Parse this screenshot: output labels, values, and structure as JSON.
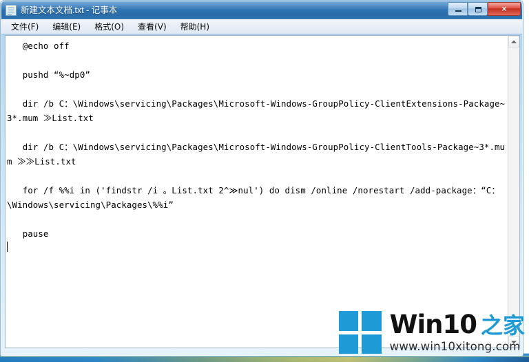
{
  "window": {
    "title": "新建文本文档.txt - 记事本",
    "icon": "notepad-icon",
    "caption": {
      "minimize_label": "最小化",
      "maximize_label": "最大化",
      "close_label": "×"
    }
  },
  "menu": {
    "items": [
      {
        "label": "文件(F)",
        "name": "menu-file"
      },
      {
        "label": "编辑(E)",
        "name": "menu-edit"
      },
      {
        "label": "格式(O)",
        "name": "menu-format"
      },
      {
        "label": "查看(V)",
        "name": "menu-view"
      },
      {
        "label": "帮助(H)",
        "name": "menu-help"
      }
    ]
  },
  "editor": {
    "content": "   @echo off\n\n   pushd “%~dp0”\n\n   dir /b C：\\Windows\\servicing\\Packages\\Microsoft-Windows-GroupPolicy-ClientExtensions-Package~3*.mum ≫List.txt\n\n   dir /b C：\\Windows\\servicing\\Packages\\Microsoft-Windows-GroupPolicy-ClientTools-Package~3*.mum ≫≫List.txt\n\n   for /f %%i in ('findstr /i 。List.txt 2^≫nul') do dism /online /norestart /add-package：“C：\\Windows\\servicing\\Packages\\%%i”\n\n   pause\n",
    "lines": [
      "   @echo off",
      "",
      "   pushd “%~dp0”",
      "",
      "   dir /b C：\\Windows\\servicing\\Packages\\Microsoft-Windows-GroupPolicy-ClientExtensions-Package~3*.mum ≫List.txt",
      "",
      "   dir /b C：\\Windows\\servicing\\Packages\\Microsoft-Windows-GroupPolicy-ClientTools-Package~3*.mum ≫≫List.txt",
      "",
      "   for /f %%i in ('findstr /i 。List.txt 2^≫nul') do dism /online /norestart /add-package：“C：\\Windows\\servicing\\Packages\\%%i”",
      "",
      "   pause"
    ],
    "wordwrap": true
  },
  "scrollbar": {
    "up_arrow": "scroll-up-arrow",
    "down_arrow": "scroll-down-arrow"
  },
  "watermark": {
    "brand": "Win10",
    "brand_suffix": "之家",
    "url": "www.win10xitong.com",
    "logo": "windows-logo"
  },
  "colors": {
    "titlebar": "#2e74b5",
    "accent": "#1e9bd7",
    "close_button": "#c6301f",
    "frame": "#aed2ee",
    "text": "#000000"
  }
}
